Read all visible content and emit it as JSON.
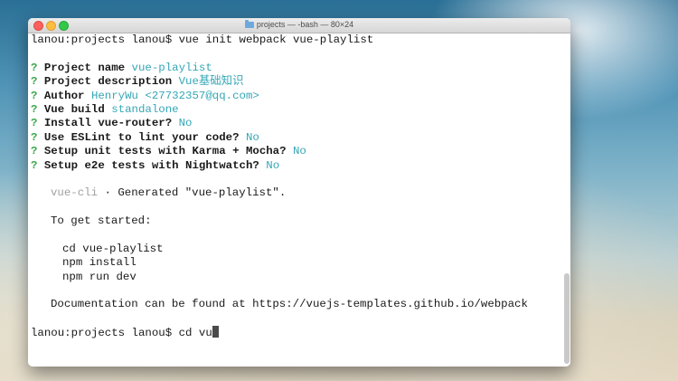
{
  "window": {
    "title": "projects — -bash — 80×24"
  },
  "terminal": {
    "prompt": "lanou:projects lanou$",
    "command1": "vue init webpack vue-playlist",
    "questions": [
      {
        "mark": "?",
        "label": "Project name",
        "answer": "vue-playlist"
      },
      {
        "mark": "?",
        "label": "Project description",
        "answer": "Vue基础知识"
      },
      {
        "mark": "?",
        "label": "Author",
        "answer": "HenryWu <27732357@qq.com>"
      },
      {
        "mark": "?",
        "label": "Vue build",
        "answer": "standalone"
      },
      {
        "mark": "?",
        "label": "Install vue-router?",
        "answer": "No"
      },
      {
        "mark": "?",
        "label": "Use ESLint to lint your code?",
        "answer": "No"
      },
      {
        "mark": "?",
        "label": "Setup unit tests with Karma + Mocha?",
        "answer": "No"
      },
      {
        "mark": "?",
        "label": "Setup e2e tests with Nightwatch?",
        "answer": "No"
      }
    ],
    "generated_tag": "vue-cli",
    "generated_sep": " · ",
    "generated_msg": "Generated \"vue-playlist\".",
    "get_started": "To get started:",
    "steps": [
      "cd vue-playlist",
      "npm install",
      "npm run dev"
    ],
    "documentation": "Documentation can be found at https://vuejs-templates.github.io/webpack",
    "command2": "cd vu"
  }
}
